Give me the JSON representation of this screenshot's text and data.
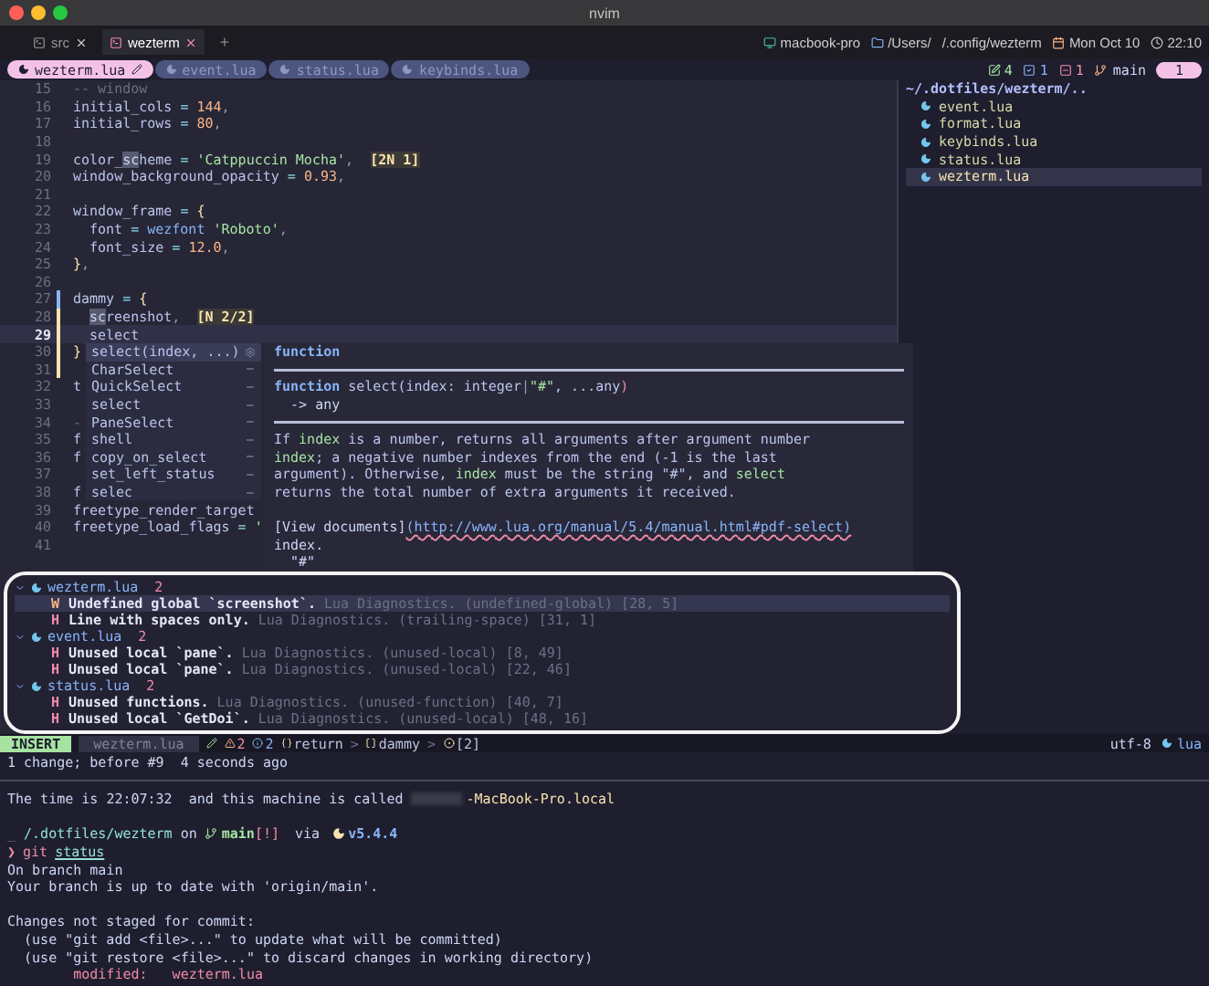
{
  "window": {
    "title": "nvim"
  },
  "tabs": [
    {
      "label": "src",
      "selected": false
    },
    {
      "label": "wezterm",
      "selected": true
    }
  ],
  "new_tab": "+",
  "status_right": [
    {
      "kind": "host",
      "text": "macbook-pro"
    },
    {
      "kind": "folder",
      "text": "/Users/"
    },
    {
      "kind": "path",
      "text": "/.config/wezterm"
    },
    {
      "kind": "date",
      "text": "Mon Oct 10"
    },
    {
      "kind": "time",
      "text": "22:10"
    }
  ],
  "buffers": [
    {
      "label": "wezterm.lua",
      "selected": true,
      "modified": true
    },
    {
      "label": "event.lua",
      "selected": false,
      "modified": false
    },
    {
      "label": "status.lua",
      "selected": false,
      "modified": false
    },
    {
      "label": "keybinds.lua",
      "selected": false,
      "modified": false
    }
  ],
  "git_summary": [
    {
      "kind": "added",
      "text": "4"
    },
    {
      "kind": "changed",
      "text": "1"
    },
    {
      "kind": "removed",
      "text": "1"
    }
  ],
  "branch": "main",
  "tab_number": "1",
  "editor": {
    "lines": [
      {
        "number": "15",
        "current": false,
        "segments": [
          {
            "kind": "comment",
            "text": "-- window"
          }
        ]
      },
      {
        "number": "16",
        "current": false,
        "segments": [
          {
            "kind": "ident",
            "text": "initial_cols"
          },
          {
            "kind": "op",
            "text": " = "
          },
          {
            "kind": "number",
            "text": "144"
          },
          {
            "kind": "punct",
            "text": ","
          }
        ]
      },
      {
        "number": "17",
        "current": false,
        "segments": [
          {
            "kind": "ident",
            "text": "initial_rows"
          },
          {
            "kind": "op",
            "text": " = "
          },
          {
            "kind": "number",
            "text": "80"
          },
          {
            "kind": "punct",
            "text": ","
          }
        ]
      },
      {
        "number": "18",
        "current": false
      },
      {
        "number": "19",
        "current": false,
        "segments": [
          {
            "kind": "ident",
            "text": "color_"
          },
          {
            "kind": "match",
            "text": "sc"
          },
          {
            "kind": "ident",
            "text": "heme"
          },
          {
            "kind": "op",
            "text": " = "
          },
          {
            "kind": "string",
            "text": "'Catppuccin Mocha'"
          },
          {
            "kind": "punct",
            "text": ",  "
          },
          {
            "kind": "hint",
            "text": "[2N 1]"
          }
        ]
      },
      {
        "number": "20",
        "current": false,
        "segments": [
          {
            "kind": "ident",
            "text": "window_background_opacity"
          },
          {
            "kind": "op",
            "text": " = "
          },
          {
            "kind": "number",
            "text": "0.93"
          },
          {
            "kind": "punct",
            "text": ","
          }
        ]
      },
      {
        "number": "21",
        "current": false
      },
      {
        "number": "22",
        "current": false,
        "segments": [
          {
            "kind": "ident",
            "text": "window_frame"
          },
          {
            "kind": "op",
            "text": " = "
          },
          {
            "kind": "brace",
            "text": "{"
          }
        ]
      },
      {
        "number": "23",
        "current": false,
        "indented": true,
        "segments": [
          {
            "kind": "ident",
            "text": "font"
          },
          {
            "kind": "op",
            "text": " = "
          },
          {
            "kind": "func",
            "text": "wezfont"
          },
          {
            "kind": "string",
            "text": " 'Roboto'"
          },
          {
            "kind": "punct",
            "text": ","
          }
        ]
      },
      {
        "number": "24",
        "current": false,
        "indented": true,
        "segments": [
          {
            "kind": "ident",
            "text": "font_size"
          },
          {
            "kind": "op",
            "text": " = "
          },
          {
            "kind": "number",
            "text": "12.0"
          },
          {
            "kind": "punct",
            "text": ","
          }
        ]
      },
      {
        "number": "25",
        "current": false,
        "segments": [
          {
            "kind": "brace",
            "text": "}"
          },
          {
            "kind": "punct",
            "text": ","
          }
        ]
      },
      {
        "number": "26",
        "current": false
      },
      {
        "number": "27",
        "current": false,
        "sign": {
          "color": "#89b4fa"
        },
        "segments": [
          {
            "kind": "ident",
            "text": "dammy"
          },
          {
            "kind": "op",
            "text": " = "
          },
          {
            "kind": "brace",
            "text": "{"
          }
        ]
      },
      {
        "number": "28",
        "current": false,
        "sign": {
          "color": "#f9e2af"
        },
        "indented": true,
        "segments": [
          {
            "kind": "match",
            "text": "sc"
          },
          {
            "kind": "ident",
            "text": "reenshot"
          },
          {
            "kind": "punct",
            "text": ",  "
          },
          {
            "kind": "hint",
            "text": "[N 2/2]"
          }
        ]
      },
      {
        "number": "29",
        "current": true,
        "sign": {
          "color": "#f9e2af"
        },
        "indented": true,
        "segments": [
          {
            "kind": "ident",
            "text": "select"
          }
        ]
      },
      {
        "number": "30",
        "current": false,
        "sign": {
          "color": "#f9e2af"
        },
        "segments": [
          {
            "kind": "brace",
            "text": "}"
          }
        ]
      },
      {
        "number": "31",
        "current": false,
        "sign": {
          "color": "#f9e2af"
        }
      },
      {
        "number": "32",
        "current": false,
        "segments": [
          {
            "kind": "ident",
            "text": "t"
          }
        ]
      },
      {
        "number": "33",
        "current": false
      },
      {
        "number": "34",
        "current": false,
        "segments": [
          {
            "kind": "comment",
            "text": "-"
          }
        ]
      },
      {
        "number": "35",
        "current": false,
        "segments": [
          {
            "kind": "ident",
            "text": "f"
          }
        ]
      },
      {
        "number": "36",
        "current": false,
        "segments": [
          {
            "kind": "ident",
            "text": "f"
          }
        ]
      },
      {
        "number": "37",
        "current": false
      },
      {
        "number": "38",
        "current": false,
        "segments": [
          {
            "kind": "ident",
            "text": "f"
          }
        ]
      },
      {
        "number": "39",
        "current": false,
        "segments": [
          {
            "kind": "ident",
            "text": "freetype_render_target"
          }
        ]
      },
      {
        "number": "40",
        "current": false,
        "segments": [
          {
            "kind": "ident",
            "text": "freetype_load_flags"
          },
          {
            "kind": "op",
            "text": " = "
          },
          {
            "kind": "string",
            "text": "'"
          }
        ]
      },
      {
        "number": "41",
        "current": false
      }
    ]
  },
  "completion": {
    "items": [
      {
        "label": "select(index, ...)",
        "kind": "function",
        "selected": true
      },
      {
        "label": "CharSelect",
        "kind": "text",
        "selected": false
      },
      {
        "label": "QuickSelect",
        "kind": "text",
        "selected": false
      },
      {
        "label": "select",
        "kind": "text",
        "selected": false
      },
      {
        "label": "PaneSelect",
        "kind": "text",
        "selected": false
      },
      {
        "label": "shell",
        "kind": "text",
        "selected": false
      },
      {
        "label": "copy_on_select",
        "kind": "text",
        "selected": false
      },
      {
        "label": "set_left_status",
        "kind": "text",
        "selected": false
      },
      {
        "label": "selec",
        "kind": "text",
        "selected": false
      }
    ]
  },
  "doc": {
    "header": "function",
    "signature": [
      {
        "kind": "keyword",
        "text": "function"
      },
      {
        "kind": "ident",
        "text": " select(index: integer"
      },
      {
        "kind": "punct",
        "text": "|"
      },
      {
        "kind": "string",
        "text": "\"#\""
      },
      {
        "kind": "ident",
        "text": ", ...any"
      },
      {
        "kind": "error",
        "text": ")"
      }
    ],
    "returns": "  -> any",
    "body": [
      [
        {
          "kind": "ident",
          "text": "If "
        },
        {
          "kind": "code",
          "text": "index"
        },
        {
          "kind": "ident",
          "text": " is a number, returns all arguments after argument number"
        }
      ],
      [
        {
          "kind": "code",
          "text": "index"
        },
        {
          "kind": "ident",
          "text": "; a negative number indexes from the end (-1 is the last"
        }
      ],
      [
        {
          "kind": "ident",
          "text": "argument). Otherwise, "
        },
        {
          "kind": "code",
          "text": "index"
        },
        {
          "kind": "ident",
          "text": " must be the string \"#\", and "
        },
        {
          "kind": "code",
          "text": "select"
        }
      ],
      [
        {
          "kind": "ident",
          "text": "returns the total number of extra arguments it received."
        }
      ]
    ],
    "link_text": "[View documents]",
    "link_url": "(http://www.lua.org/manual/5.4/manual.html#pdf-select)",
    "tail": [
      "index.",
      "  \"#\""
    ]
  },
  "file_tree": {
    "root": "~/.dotfiles/wezterm/..",
    "items": [
      {
        "name": "event.lua",
        "selected": false
      },
      {
        "name": "format.lua",
        "selected": false
      },
      {
        "name": "keybinds.lua",
        "selected": false
      },
      {
        "name": "status.lua",
        "selected": false
      },
      {
        "name": "wezterm.lua",
        "selected": true
      }
    ]
  },
  "diagnostics": {
    "groups": [
      {
        "file": "wezterm.lua",
        "count": "2",
        "expanded": true,
        "items": [
          {
            "kind": "warning",
            "severity": "W",
            "message": "Undefined global `screenshot`.",
            "source": "Lua Diagnostics. (undefined-global) [28, 5]",
            "selected": true
          },
          {
            "kind": "hint",
            "severity": "H",
            "message": "Line with spaces only.",
            "source": "Lua Diagnostics. (trailing-space) [31, 1]",
            "selected": false
          }
        ]
      },
      {
        "file": "event.lua",
        "count": "2",
        "expanded": true,
        "items": [
          {
            "kind": "hint",
            "severity": "H",
            "message": "Unused local `pane`.",
            "source": "Lua Diagnostics. (unused-local) [8, 49]",
            "selected": false
          },
          {
            "kind": "hint",
            "severity": "H",
            "message": "Unused local `pane`.",
            "source": "Lua Diagnostics. (unused-local) [22, 46]",
            "selected": false
          }
        ]
      },
      {
        "file": "status.lua",
        "count": "2",
        "expanded": true,
        "items": [
          {
            "kind": "hint",
            "severity": "H",
            "message": "Unused functions.",
            "source": "Lua Diagnostics. (unused-function) [40, 7]",
            "selected": false
          },
          {
            "kind": "hint",
            "severity": "H",
            "message": "Unused local `GetDoi`.",
            "source": "Lua Diagnostics. (unused-local) [48, 16]",
            "selected": false
          }
        ]
      }
    ]
  },
  "statusline": {
    "mode": "INSERT",
    "file": "wezterm.lua",
    "counts": [
      {
        "kind": "warning",
        "text": "2"
      },
      {
        "kind": "info",
        "text": "2"
      }
    ],
    "breadcrumbs": [
      {
        "kind": "braces",
        "text": "return"
      },
      {
        "kind": "brackets",
        "text": "dammy"
      },
      {
        "kind": "circle",
        "text": "[2]"
      }
    ],
    "separator": ">",
    "encoding": "utf-8",
    "filetype": "lua"
  },
  "message": "1 change; before #9  4 seconds ago",
  "terminal": {
    "lines": [
      {
        "segments": [
          {
            "kind": "plain",
            "text": "The time is "
          },
          {
            "kind": "plain",
            "text": "22:07:32"
          },
          {
            "kind": "plain",
            "text": "  and this machine is called "
          },
          {
            "kind": "redacted"
          },
          {
            "kind": "host",
            "text": "-MacBook-Pro.local"
          }
        ]
      },
      {
        "gap_before": true,
        "segments": [
          {
            "kind": "dim",
            "text": "_"
          },
          {
            "kind": "path",
            "text": " /.dotfiles/wezterm"
          },
          {
            "kind": "plain",
            "text": " on "
          },
          {
            "kind": "branch_icon"
          },
          {
            "kind": "branch",
            "text": "main"
          },
          {
            "kind": "alert",
            "text": "[!]"
          },
          {
            "kind": "plain",
            "text": " via "
          },
          {
            "kind": "moon_icon"
          },
          {
            "kind": "version",
            "text": "v5.4.4"
          }
        ]
      },
      {
        "segments": [
          {
            "kind": "prompt",
            "text": "❯"
          },
          {
            "kind": "command",
            "text": "git"
          },
          {
            "kind": "arg",
            "text": "status"
          }
        ]
      },
      {
        "segments": [
          {
            "kind": "plain",
            "text": "On branch main"
          }
        ]
      },
      {
        "segments": [
          {
            "kind": "plain",
            "text": "Your branch is up to date with 'origin/main'."
          }
        ]
      },
      {
        "gap_before": true,
        "segments": [
          {
            "kind": "plain",
            "text": "Changes not staged for commit:"
          }
        ]
      },
      {
        "segments": [
          {
            "kind": "plain",
            "text": "  (use \"git add <file>...\" to update what will be committed)"
          }
        ]
      },
      {
        "segments": [
          {
            "kind": "plain",
            "text": "  (use \"git restore <file>...\" to discard changes in working directory)"
          }
        ]
      },
      {
        "segments": [
          {
            "kind": "modified",
            "text": "        modified:   wezterm.lua"
          }
        ]
      }
    ]
  }
}
